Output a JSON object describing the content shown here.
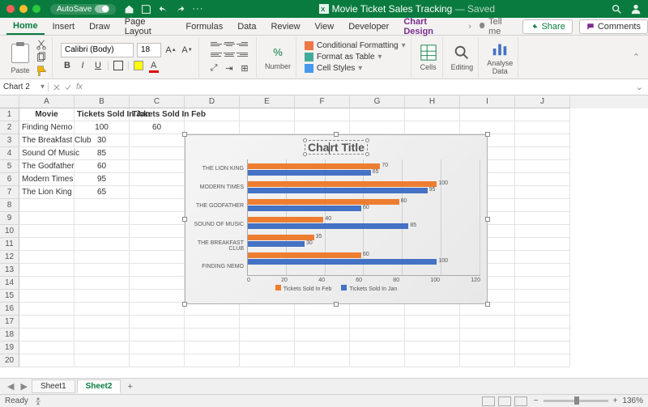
{
  "titlebar": {
    "autosave": "AutoSave",
    "doc": "Movie Ticket Sales Tracking",
    "status": "Saved"
  },
  "tabs": [
    "Home",
    "Insert",
    "Draw",
    "Page Layout",
    "Formulas",
    "Data",
    "Review",
    "View",
    "Developer",
    "Chart Design"
  ],
  "tellme": "Tell me",
  "share": "Share",
  "comments": "Comments",
  "ribbon": {
    "paste": "Paste",
    "font": "Calibri (Body)",
    "size": "18",
    "number": "Number",
    "cf": "Conditional Formatting",
    "fat": "Format as Table",
    "cs": "Cell Styles",
    "cells": "Cells",
    "editing": "Editing",
    "analyse": "Analyse\nData"
  },
  "namebox": "Chart 2",
  "columns": [
    "A",
    "B",
    "C",
    "D",
    "E",
    "F",
    "G",
    "H",
    "I",
    "J"
  ],
  "headers": {
    "a": "Movie",
    "b": "Tickets Sold In Jan",
    "c": "Tickets Sold In Feb"
  },
  "movies": [
    {
      "name": "Finding Nemo",
      "jan": "100",
      "feb": "60"
    },
    {
      "name": "The Breakfast Club",
      "jan": "30",
      "feb": ""
    },
    {
      "name": "Sound Of Music",
      "jan": "85",
      "feb": ""
    },
    {
      "name": "The Godfather",
      "jan": "60",
      "feb": ""
    },
    {
      "name": "Modern Times",
      "jan": "95",
      "feb": ""
    },
    {
      "name": "The Lion King",
      "jan": "65",
      "feb": ""
    }
  ],
  "chart": {
    "title": "Chart Title",
    "series1": "Tickets Sold In Feb",
    "series2": "Tickets Sold In Jan",
    "cats": [
      "THE LION KING",
      "MODERN TIMES",
      "THE GODFATHER",
      "SOUND OF MUSIC",
      "THE BREAKFAST CLUB",
      "FINDING NEMO"
    ],
    "xticks": [
      "0",
      "20",
      "40",
      "60",
      "80",
      "100",
      "120"
    ]
  },
  "chart_data": {
    "type": "bar",
    "orientation": "horizontal",
    "categories": [
      "THE LION KING",
      "MODERN TIMES",
      "THE GODFATHER",
      "SOUND OF MUSIC",
      "THE BREAKFAST CLUB",
      "FINDING NEMO"
    ],
    "series": [
      {
        "name": "Tickets Sold In Feb",
        "values": [
          70,
          100,
          80,
          40,
          35,
          60
        ],
        "color": "#ed7d31"
      },
      {
        "name": "Tickets Sold In Jan",
        "values": [
          65,
          95,
          60,
          85,
          30,
          100
        ],
        "color": "#4472c4"
      }
    ],
    "title": "Chart Title",
    "xlabel": "",
    "ylabel": "",
    "xlim": [
      0,
      120
    ],
    "xticks": [
      0,
      20,
      40,
      60,
      80,
      100,
      120
    ]
  },
  "sheets": {
    "s1": "Sheet1",
    "s2": "Sheet2"
  },
  "status": {
    "ready": "Ready",
    "zoom": "136%"
  }
}
